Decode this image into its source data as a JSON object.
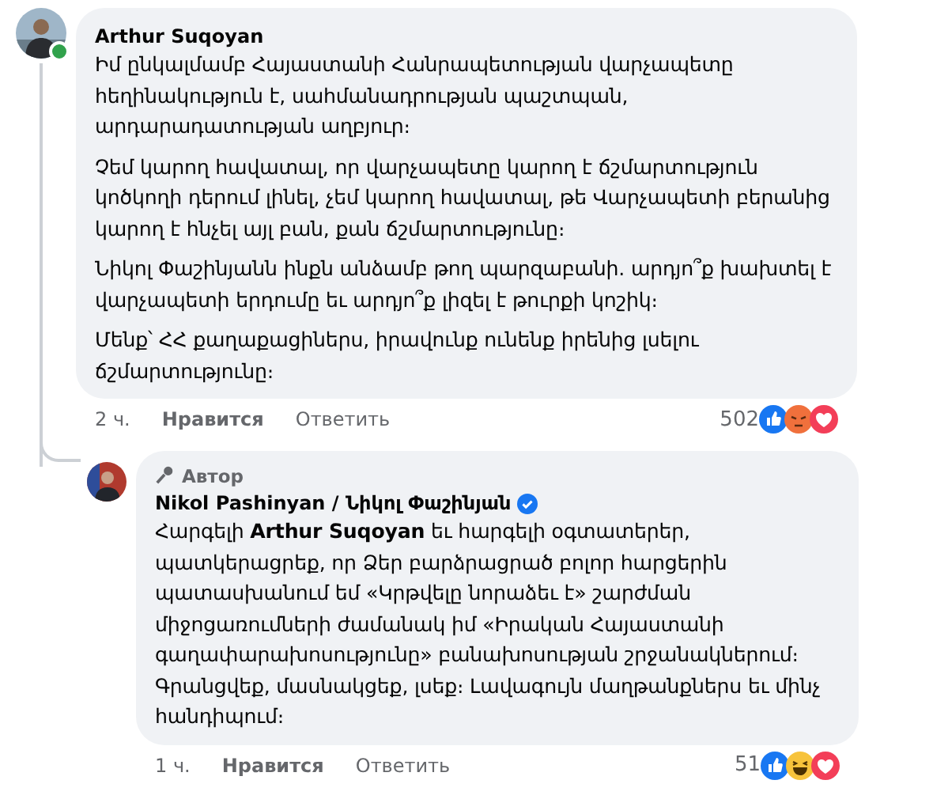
{
  "comment": {
    "author": "Arthur Suqoyan",
    "online": true,
    "paragraphs": [
      "Իմ ընկալմամբ Հայաստանի Հանրապետության վարչապետը հեղինակություն է, սահմանադրության պաշտպան, արդարադատության աղբյուր։",
      "Չեմ կարող հավատալ, որ վարչապետը կարող է ճշմարտություն կոծկողի դերում լինել, չեմ կարող հավատալ, թե Վարչապետի բերանից կարող է հնչել այլ բան, քան ճշմարտությունը։",
      "Նիկոլ Փաշինյանն ինքն անձամբ թող պարզաբանի. արդյո՞ք խախտել է վարչապետի երդումը եւ արդյո՞ք լիզել է թուրքի կոշիկ։",
      "Մենք՝ ՀՀ քաղաքացիներս, իրավունք ունենք իրենից լսելու ճշմարտությունը։"
    ],
    "time": "2 ч.",
    "like": "Нравится",
    "reply": "Ответить",
    "reaction_count": "502",
    "reactions": [
      {
        "kind": "like"
      },
      {
        "kind": "angry"
      },
      {
        "kind": "love"
      }
    ]
  },
  "reply": {
    "badge": "Автор",
    "author": "Nikol Pashinyan / Նիկոլ Փաշինյան",
    "verified": true,
    "paragraphs": [
      "Հարգելի **Arthur Suqoyan** եւ հարգելի օգտատերեր, պատկերացրեք, որ Ձեր բարձրացրած բոլոր հարցերին պատասխանում եմ «Կրթվելը նորաձեւ է» շարժման միջոցառումների ժամանակ իմ «Իրական Հայաստանի գաղափարախոսությունը» բանախոսության շրջանակներում։ Գրանցվեք, մասնակցեք, լսեք։ Լավագույն մաղթանքներս եւ մինչ հանդիպում։"
    ],
    "time": "1 ч.",
    "like": "Нравится",
    "reply": "Ответить",
    "reaction_count": "51",
    "reactions": [
      {
        "kind": "like"
      },
      {
        "kind": "haha"
      },
      {
        "kind": "love"
      }
    ]
  }
}
